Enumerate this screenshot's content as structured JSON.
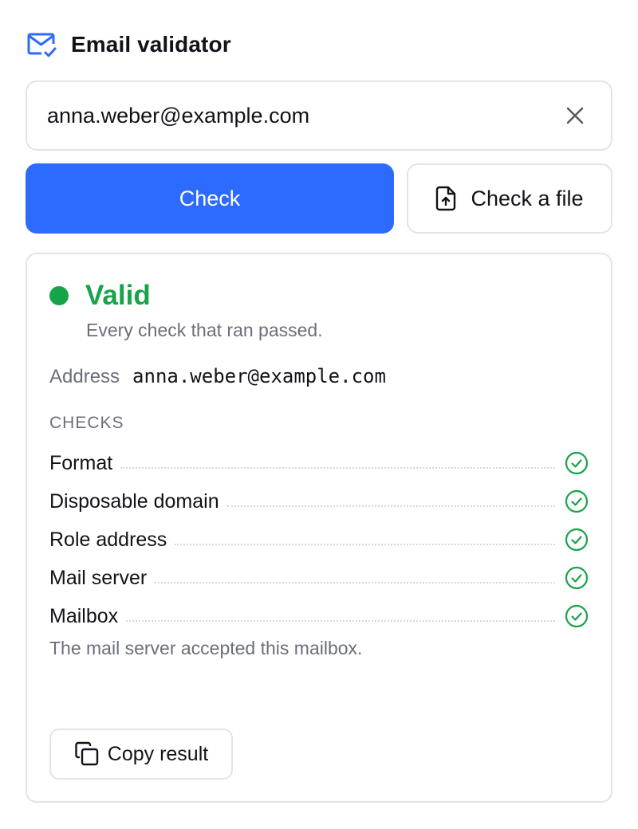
{
  "header": {
    "title": "Email validator",
    "icon": "mail-check-icon"
  },
  "input": {
    "value": "anna.weber@example.com",
    "clear_icon": "close-icon"
  },
  "actions": {
    "check_label": "Check",
    "file_label": "Check a file",
    "file_icon": "file-upload-icon"
  },
  "result": {
    "status": "Valid",
    "status_color": "#17a34a",
    "status_message": "Every check that ran passed.",
    "address_label": "Address",
    "address_value": "anna.weber@example.com",
    "checks_heading": "CHECKS",
    "checks": [
      {
        "label": "Format",
        "state": "passed"
      },
      {
        "label": "Disposable domain",
        "state": "passed"
      },
      {
        "label": "Role address",
        "state": "passed"
      },
      {
        "label": "Mail server",
        "state": "passed"
      },
      {
        "label": "Mailbox",
        "state": "passed"
      }
    ],
    "note": "The mail server accepted this mailbox.",
    "copy_label": "Copy result",
    "copy_icon": "copy-icon"
  },
  "colors": {
    "accent": "#2d6bff",
    "success": "#17a34a",
    "border": "#e3e4e8",
    "muted": "#6b6f7a"
  }
}
